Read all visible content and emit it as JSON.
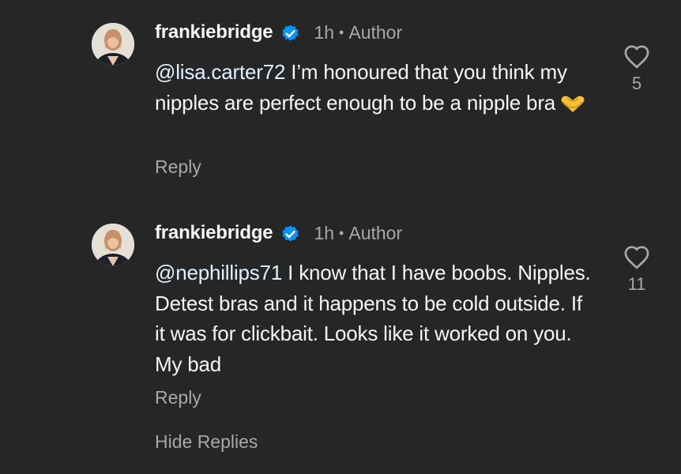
{
  "comments": [
    {
      "username": "frankiebridge",
      "time": "1h",
      "separator": "•",
      "badge": "Author",
      "mention": "@lisa.carter72",
      "text": " I’m honoured that you think my nipples are perfect enough to be a nipple bra",
      "emoji": "heart-hands",
      "likes": "5",
      "reply_label": "Reply"
    },
    {
      "username": "frankiebridge",
      "time": "1h",
      "separator": "•",
      "badge": "Author",
      "mention": "@nephillips71",
      "text": " I know that I have boobs. Nipples. Detest bras and it happens to be cold outside. If it was for clickbait. Looks like it worked on you. My bad",
      "likes": "11",
      "reply_label": "Reply"
    }
  ],
  "hide_replies_label": "Hide Replies",
  "colors": {
    "background": "#262626",
    "text": "#f5f5f5",
    "muted": "#a8a8a8",
    "verified": "#0095f6",
    "emoji": "#f7c23a"
  }
}
